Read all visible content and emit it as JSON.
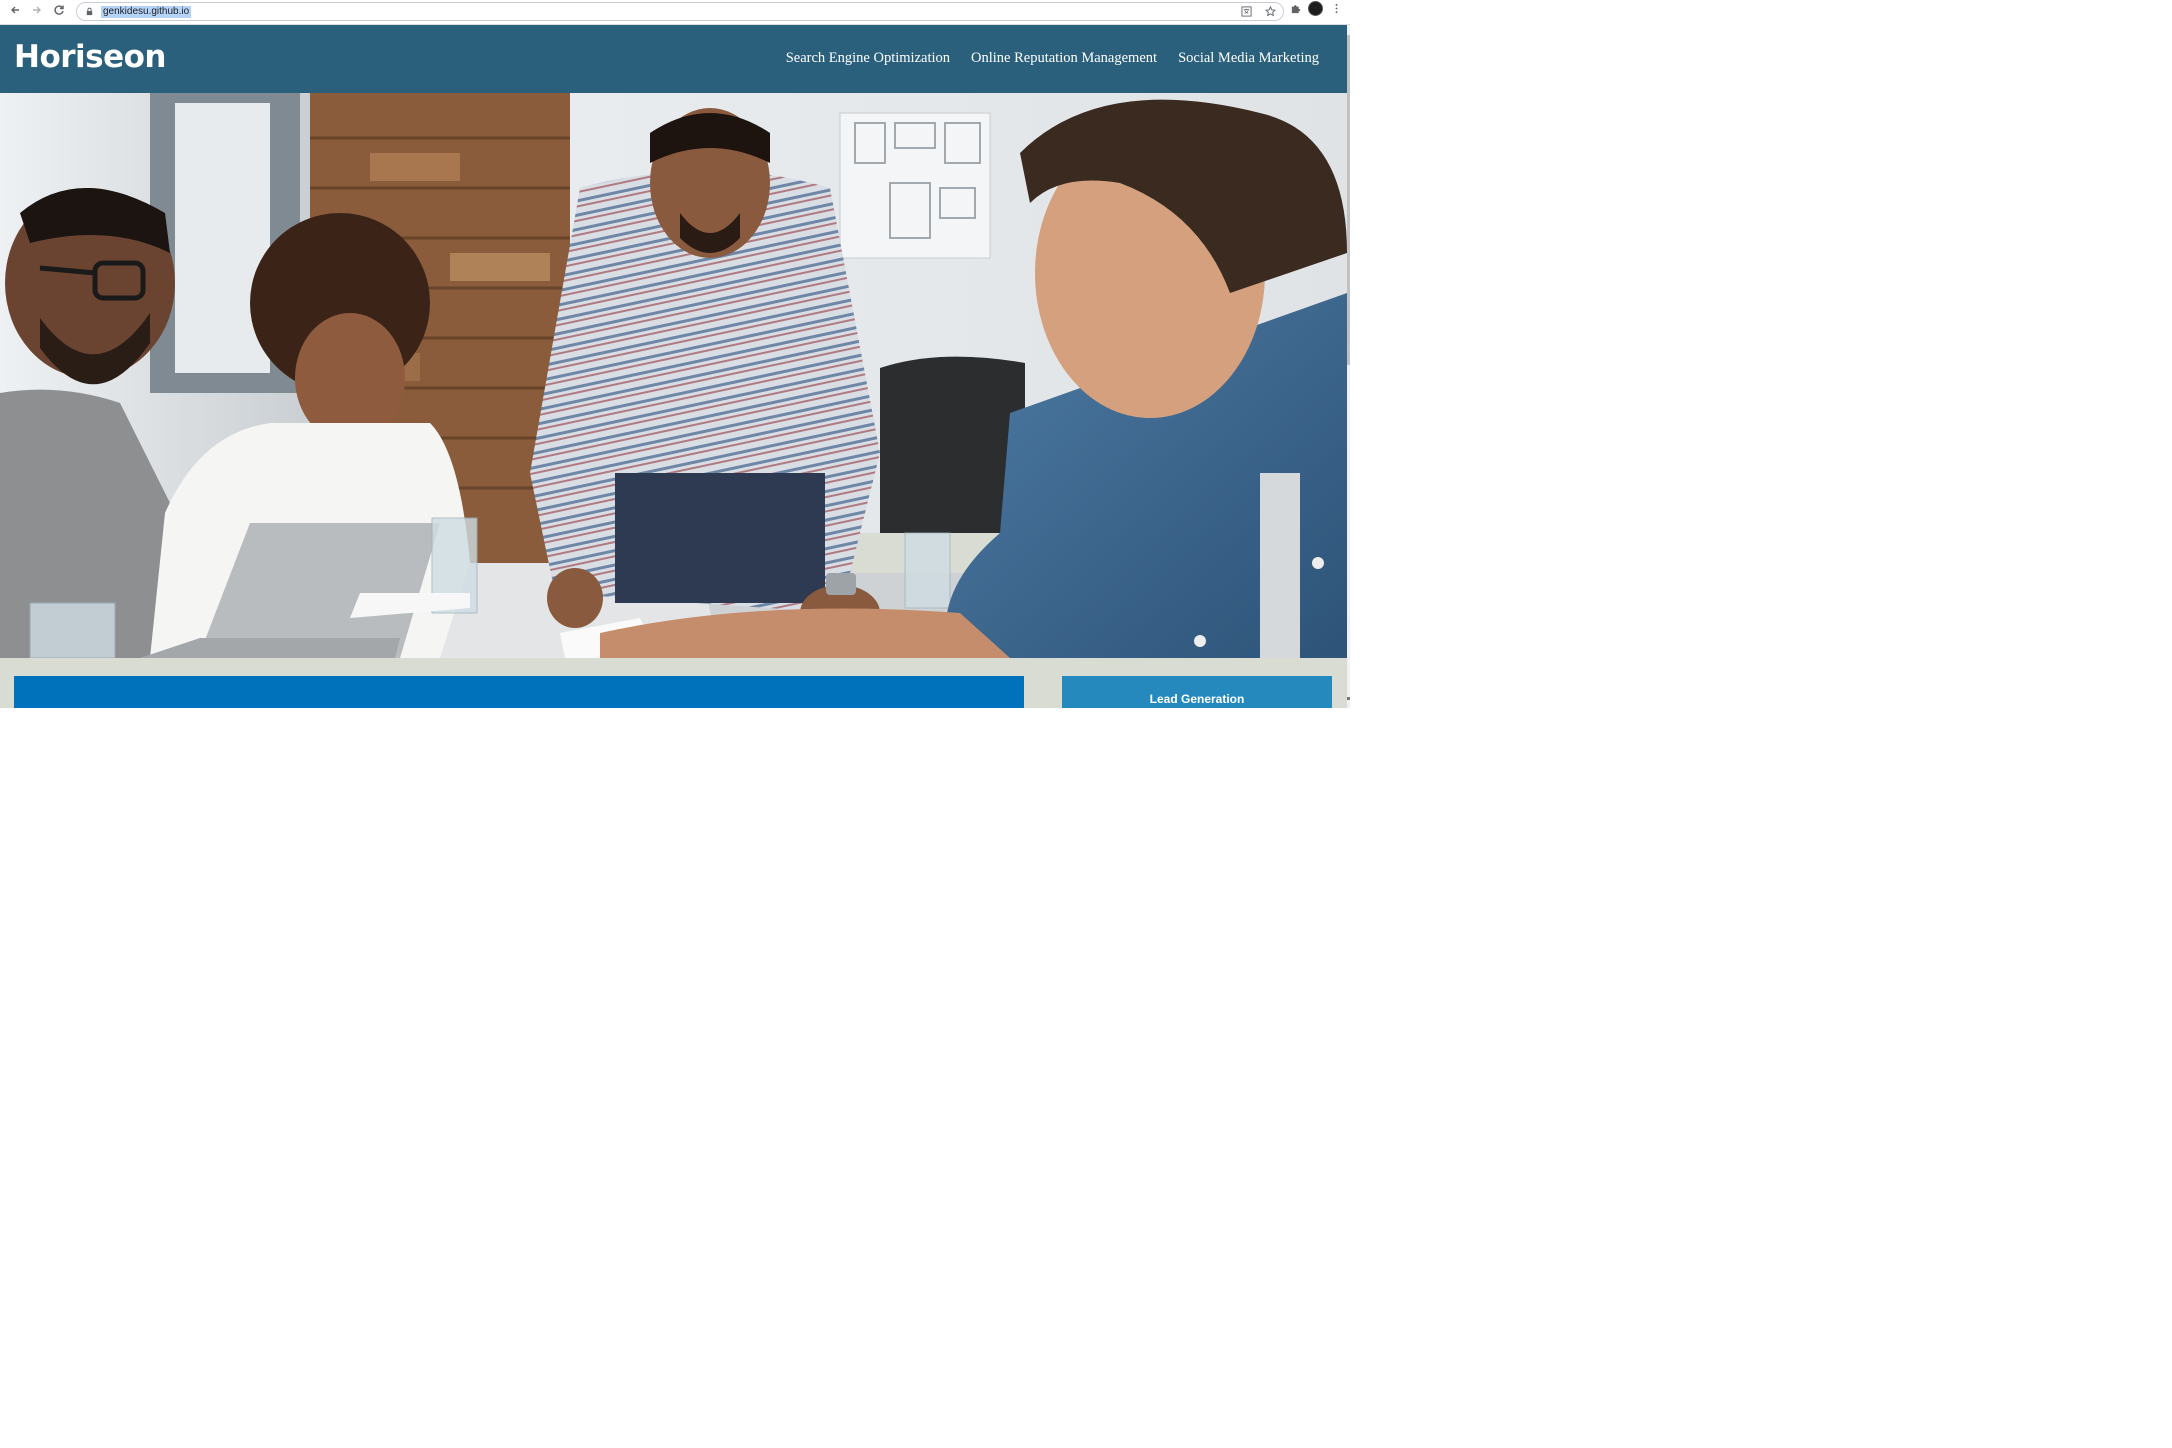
{
  "browser": {
    "url": "genkidesu.github.io",
    "icons": {
      "back": "arrow-left-icon",
      "forward": "arrow-right-icon",
      "reload": "reload-icon",
      "lock": "lock-icon",
      "translate": "translate-icon",
      "bookmark": "star-icon",
      "extensions": "puzzle-icon",
      "profile": "avatar",
      "menu": "kebab-menu-icon"
    }
  },
  "site": {
    "brand": "Horiseon",
    "nav": [
      {
        "label": "Search Engine Optimization"
      },
      {
        "label": "Online Reputation Management"
      },
      {
        "label": "Social Media Marketing"
      }
    ],
    "aside_title": "Lead Generation",
    "colors": {
      "header": "#2a607c",
      "banner": "#0072bb",
      "aside": "#2589bd"
    }
  }
}
